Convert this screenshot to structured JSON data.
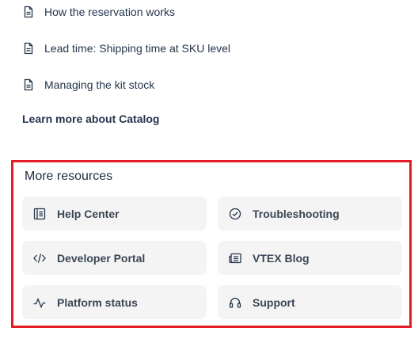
{
  "articles": [
    {
      "label": "How the reservation works",
      "icon": "document-icon"
    },
    {
      "label": "Lead time: Shipping time at SKU level",
      "icon": "document-icon"
    },
    {
      "label": "Managing the kit stock",
      "icon": "document-icon"
    }
  ],
  "learn_more": "Learn more about Catalog",
  "resources": {
    "title": "More resources",
    "items": [
      {
        "label": "Help Center",
        "icon": "book-icon"
      },
      {
        "label": "Troubleshooting",
        "icon": "check-circle-icon"
      },
      {
        "label": "Developer Portal",
        "icon": "code-icon"
      },
      {
        "label": "VTEX Blog",
        "icon": "newspaper-icon"
      },
      {
        "label": "Platform status",
        "icon": "pulse-icon"
      },
      {
        "label": "Support",
        "icon": "headset-icon"
      }
    ]
  },
  "colors": {
    "highlight_border": "#e21d26",
    "card_background": "#f4f4f4",
    "text": "#25354d"
  }
}
